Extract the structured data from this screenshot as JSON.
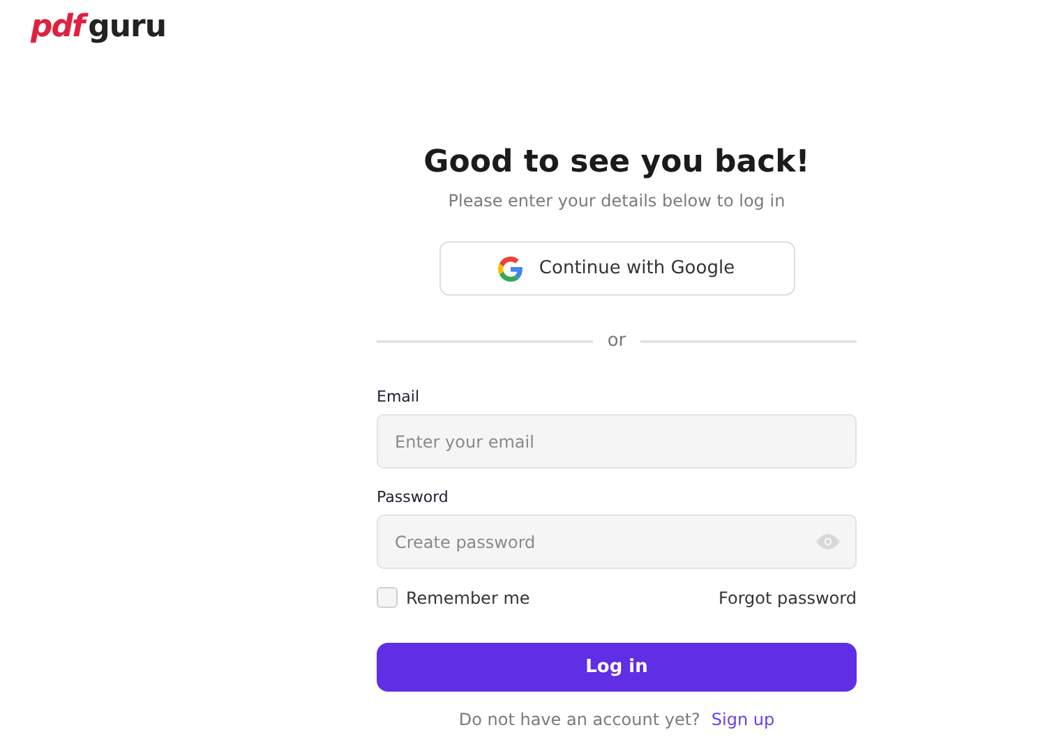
{
  "logo": {
    "part_1": "pdf",
    "part_2": "guru"
  },
  "heading": "Good to see you back!",
  "subheading": "Please enter your details below to log in",
  "google_button": "Continue with Google",
  "divider": "or",
  "fields": [
    {
      "label": "Email",
      "placeholder": "Enter your email",
      "kind": "email"
    },
    {
      "label": "Password",
      "placeholder": "Create password",
      "kind": "password"
    }
  ],
  "remember": {
    "label": "Remember me",
    "checked": false
  },
  "forgot_link": "Forgot password",
  "login_button": "Log in",
  "signup": {
    "text": "Do not have an account yet?",
    "link": "Sign up"
  }
}
